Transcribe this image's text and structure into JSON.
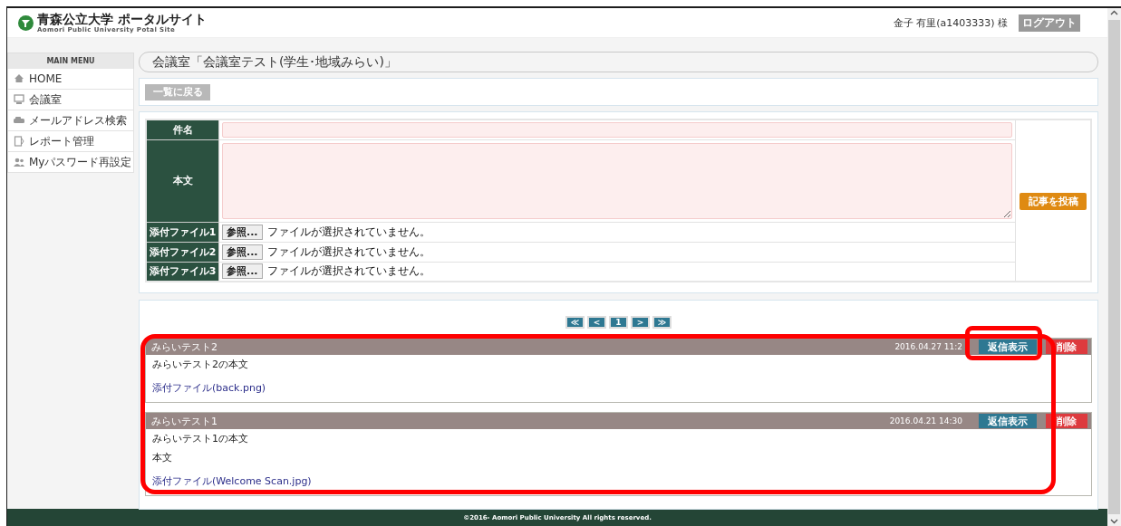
{
  "header": {
    "site_title": "青森公立大学 ポータルサイト",
    "site_subtitle": "Aomori Public University Potal Site",
    "user": "金子 有里(a1403333) 様",
    "logout_button": "ログアウト"
  },
  "sidebar": {
    "heading": "MAIN MENU",
    "items": [
      {
        "label": "HOME",
        "kind": "home"
      },
      {
        "label": "会議室",
        "kind": "meeting"
      },
      {
        "label": "メールアドレス検索",
        "kind": "search"
      },
      {
        "label": "レポート管理",
        "kind": "report"
      },
      {
        "label": "Myパスワード再設定",
        "kind": "password"
      }
    ]
  },
  "page_title": "会議室「会議室テスト(学生･地域みらい)」",
  "back_button": "一覧に戻る",
  "form": {
    "fields": [
      {
        "label": "件名",
        "kind": "text"
      },
      {
        "label": "本文",
        "kind": "textarea"
      },
      {
        "label": "添付ファイル1",
        "kind": "file",
        "button": "参照...",
        "status": "ファイルが選択されていません。"
      },
      {
        "label": "添付ファイル2",
        "kind": "file",
        "button": "参照...",
        "status": "ファイルが選択されていません。"
      },
      {
        "label": "添付ファイル3",
        "kind": "file",
        "button": "参照...",
        "status": "ファイルが選択されていません。"
      }
    ],
    "submit_button": "記事を投稿"
  },
  "pager": [
    "≪",
    "<",
    "1",
    ">",
    "≫"
  ],
  "posts_highlighted": true,
  "posts": [
    {
      "title": "みらいテスト2",
      "date": "2016.04.27 11:2",
      "reply_button": "返信表示",
      "reply_highlighted": true,
      "delete_button": "削除",
      "body": [
        "みらいテスト2の本文"
      ],
      "attachment": "添付ファイル(back.png)"
    },
    {
      "title": "みらいテスト1",
      "date": "2016.04.21 14:30",
      "reply_button": "返信表示",
      "reply_highlighted": false,
      "delete_button": "削除",
      "body": [
        "みらいテスト1の本文",
        "本文"
      ],
      "attachment": "添付ファイル(Welcome Scan.jpg)"
    }
  ],
  "footer": "©2016- Aomori Public University All rights reserved."
}
